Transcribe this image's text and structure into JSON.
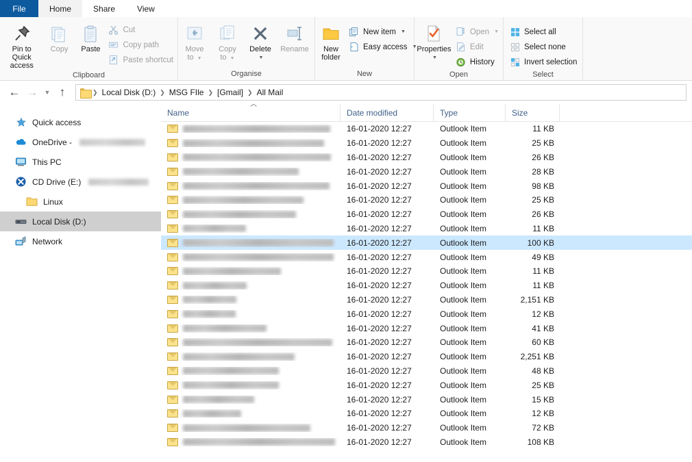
{
  "tabs": [
    {
      "label": "File",
      "kind": "file"
    },
    {
      "label": "Home",
      "kind": "active"
    },
    {
      "label": "Share",
      "kind": "normal"
    },
    {
      "label": "View",
      "kind": "normal"
    }
  ],
  "ribbon": {
    "groups": [
      {
        "label": "Clipboard",
        "big": [
          {
            "label": "Pin to Quick\naccess",
            "icon": "pin-icon",
            "dim": false
          },
          {
            "label": "Copy",
            "icon": "copy-icon",
            "dim": true
          },
          {
            "label": "Paste",
            "icon": "paste-icon",
            "dim": false
          }
        ],
        "small": [
          {
            "label": "Cut",
            "icon": "scissors-icon",
            "dim": true
          },
          {
            "label": "Copy path",
            "icon": "copy-path-icon",
            "dim": true
          },
          {
            "label": "Paste shortcut",
            "icon": "paste-shortcut-icon",
            "dim": true
          }
        ]
      },
      {
        "label": "Organise",
        "big": [
          {
            "label": "Move\nto",
            "icon": "move-to-icon",
            "dim": true,
            "caret": true
          },
          {
            "label": "Copy\nto",
            "icon": "copy-to-icon",
            "dim": true,
            "caret": true
          },
          {
            "label": "Delete",
            "icon": "delete-icon",
            "dim": false,
            "caret": true
          },
          {
            "label": "Rename",
            "icon": "rename-icon",
            "dim": true
          }
        ],
        "small": []
      },
      {
        "label": "New",
        "big": [
          {
            "label": "New\nfolder",
            "icon": "new-folder-icon",
            "dim": false
          }
        ],
        "small": [
          {
            "label": "New item",
            "icon": "new-item-icon",
            "dim": false,
            "caret": true
          },
          {
            "label": "Easy access",
            "icon": "easy-access-icon",
            "dim": false,
            "caret": true
          }
        ]
      },
      {
        "label": "Open",
        "big": [
          {
            "label": "Properties",
            "icon": "properties-icon",
            "dim": false,
            "caret": true
          }
        ],
        "small": [
          {
            "label": "Open",
            "icon": "open-icon",
            "dim": true,
            "caret": true
          },
          {
            "label": "Edit",
            "icon": "edit-icon",
            "dim": true
          },
          {
            "label": "History",
            "icon": "history-icon",
            "dim": false
          }
        ]
      },
      {
        "label": "Select",
        "big": [],
        "small": [
          {
            "label": "Select all",
            "icon": "select-all-icon",
            "dim": false
          },
          {
            "label": "Select none",
            "icon": "select-none-icon",
            "dim": false
          },
          {
            "label": "Invert selection",
            "icon": "invert-selection-icon",
            "dim": false
          }
        ]
      }
    ]
  },
  "navigation": {
    "back_icon": "back-arrow-icon",
    "forward_icon": "forward-arrow-icon",
    "recent_icon": "chevron-down-icon",
    "up_icon": "up-arrow-icon",
    "breadcrumb": [
      "Local Disk (D:)",
      "MSG FIle",
      "[Gmail]",
      "All Mail"
    ]
  },
  "sidebar": {
    "items": [
      {
        "label": "Quick access",
        "icon": "star-pin-icon",
        "redacted": null,
        "indent": false,
        "selected": false
      },
      {
        "label": "OneDrive - ",
        "icon": "onedrive-cloud-icon",
        "redacted": 96,
        "indent": false,
        "selected": false
      },
      {
        "label": "This PC",
        "icon": "this-pc-icon",
        "redacted": null,
        "indent": false,
        "selected": false
      },
      {
        "label": "CD Drive (E:)",
        "icon": "cd-drive-icon",
        "redacted": 88,
        "indent": false,
        "selected": false
      },
      {
        "label": "Linux",
        "icon": "folder-icon",
        "redacted": null,
        "indent": true,
        "selected": false
      },
      {
        "label": "Local Disk (D:)",
        "icon": "hard-disk-icon",
        "redacted": null,
        "indent": false,
        "selected": true
      },
      {
        "label": "Network",
        "icon": "network-icon",
        "redacted": null,
        "indent": false,
        "selected": false
      }
    ]
  },
  "filelist": {
    "columns": [
      "Name",
      "Date modified",
      "Type",
      "Size"
    ],
    "sort_indicator": "ascending",
    "rows": [
      {
        "name_width": 215,
        "date": "16-01-2020 12:27",
        "type": "Outlook Item",
        "size": "11 KB",
        "selected": false
      },
      {
        "name_width": 206,
        "date": "16-01-2020 12:27",
        "type": "Outlook Item",
        "size": "25 KB",
        "selected": false
      },
      {
        "name_width": 216,
        "date": "16-01-2020 12:27",
        "type": "Outlook Item",
        "size": "26 KB",
        "selected": false
      },
      {
        "name_width": 169,
        "date": "16-01-2020 12:27",
        "type": "Outlook Item",
        "size": "28 KB",
        "selected": false
      },
      {
        "name_width": 214,
        "date": "16-01-2020 12:27",
        "type": "Outlook Item",
        "size": "98 KB",
        "selected": false
      },
      {
        "name_width": 176,
        "date": "16-01-2020 12:27",
        "type": "Outlook Item",
        "size": "25 KB",
        "selected": false
      },
      {
        "name_width": 165,
        "date": "16-01-2020 12:27",
        "type": "Outlook Item",
        "size": "26 KB",
        "selected": false
      },
      {
        "name_width": 92,
        "date": "16-01-2020 12:27",
        "type": "Outlook Item",
        "size": "11 KB",
        "selected": false
      },
      {
        "name_width": 220,
        "date": "16-01-2020 12:27",
        "type": "Outlook Item",
        "size": "100 KB",
        "selected": true
      },
      {
        "name_width": 220,
        "date": "16-01-2020 12:27",
        "type": "Outlook Item",
        "size": "49 KB",
        "selected": false
      },
      {
        "name_width": 143,
        "date": "16-01-2020 12:27",
        "type": "Outlook Item",
        "size": "11 KB",
        "selected": false
      },
      {
        "name_width": 93,
        "date": "16-01-2020 12:27",
        "type": "Outlook Item",
        "size": "11 KB",
        "selected": false
      },
      {
        "name_width": 78,
        "date": "16-01-2020 12:27",
        "type": "Outlook Item",
        "size": "2,151 KB",
        "selected": false
      },
      {
        "name_width": 77,
        "date": "16-01-2020 12:27",
        "type": "Outlook Item",
        "size": "12 KB",
        "selected": false
      },
      {
        "name_width": 122,
        "date": "16-01-2020 12:27",
        "type": "Outlook Item",
        "size": "41 KB",
        "selected": false
      },
      {
        "name_width": 218,
        "date": "16-01-2020 12:27",
        "type": "Outlook Item",
        "size": "60 KB",
        "selected": false
      },
      {
        "name_width": 163,
        "date": "16-01-2020 12:27",
        "type": "Outlook Item",
        "size": "2,251 KB",
        "selected": false
      },
      {
        "name_width": 140,
        "date": "16-01-2020 12:27",
        "type": "Outlook Item",
        "size": "48 KB",
        "selected": false
      },
      {
        "name_width": 140,
        "date": "16-01-2020 12:27",
        "type": "Outlook Item",
        "size": "25 KB",
        "selected": false
      },
      {
        "name_width": 104,
        "date": "16-01-2020 12:27",
        "type": "Outlook Item",
        "size": "15 KB",
        "selected": false
      },
      {
        "name_width": 85,
        "date": "16-01-2020 12:27",
        "type": "Outlook Item",
        "size": "12 KB",
        "selected": false
      },
      {
        "name_width": 186,
        "date": "16-01-2020 12:27",
        "type": "Outlook Item",
        "size": "72 KB",
        "selected": false
      },
      {
        "name_width": 222,
        "date": "16-01-2020 12:27",
        "type": "Outlook Item",
        "size": "108 KB",
        "selected": false
      }
    ]
  },
  "colors": {
    "file_tab_blue": "#0d5a9e",
    "selection_blue": "#cce8ff",
    "header_text": "#40618a",
    "envelope_gold": "#fbe38d",
    "folder_yellow": "#fcd975"
  }
}
